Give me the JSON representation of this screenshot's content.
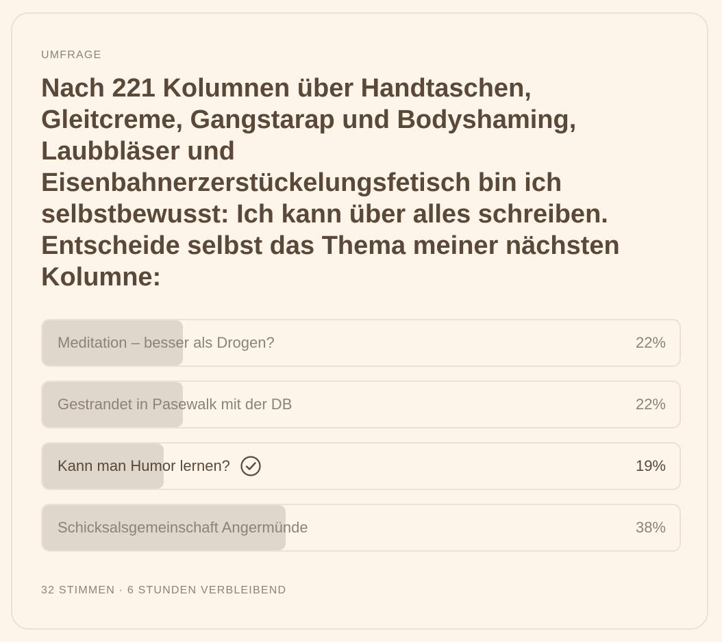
{
  "poll": {
    "eyebrow": "UMFRAGE",
    "question": "Nach 221 Kolumnen über Handtaschen, Gleitcreme, Gangstarap und Bodyshaming, Laubbläser und Eisenbahnerzerstückelungsfetisch bin ich selbstbewusst: Ich kann über alles schreiben. Entscheide selbst das Thema meiner nächsten Kolumne:",
    "options": [
      {
        "label": "Meditation – besser als Drogen?",
        "percent_text": "22%",
        "share": 0.22,
        "selected": false
      },
      {
        "label": "Gestrandet in Pasewalk mit der DB",
        "percent_text": "22%",
        "share": 0.22,
        "selected": false
      },
      {
        "label": "Kann man Humor lernen?",
        "percent_text": "19%",
        "share": 0.19,
        "selected": true,
        "icon": "check-circle-icon"
      },
      {
        "label": "Schicksalsgemeinschaft Angermünde",
        "percent_text": "38%",
        "share": 0.38,
        "selected": false
      }
    ],
    "footer": "32 STIMMEN · 6 STUNDEN VERBLEIBEND"
  },
  "colors": {
    "background": "#fdf5ea",
    "border": "#ebe1d4",
    "bar_fill": "#dfd6cc",
    "text_dark": "#5a4838",
    "text_muted": "#8c8378"
  }
}
